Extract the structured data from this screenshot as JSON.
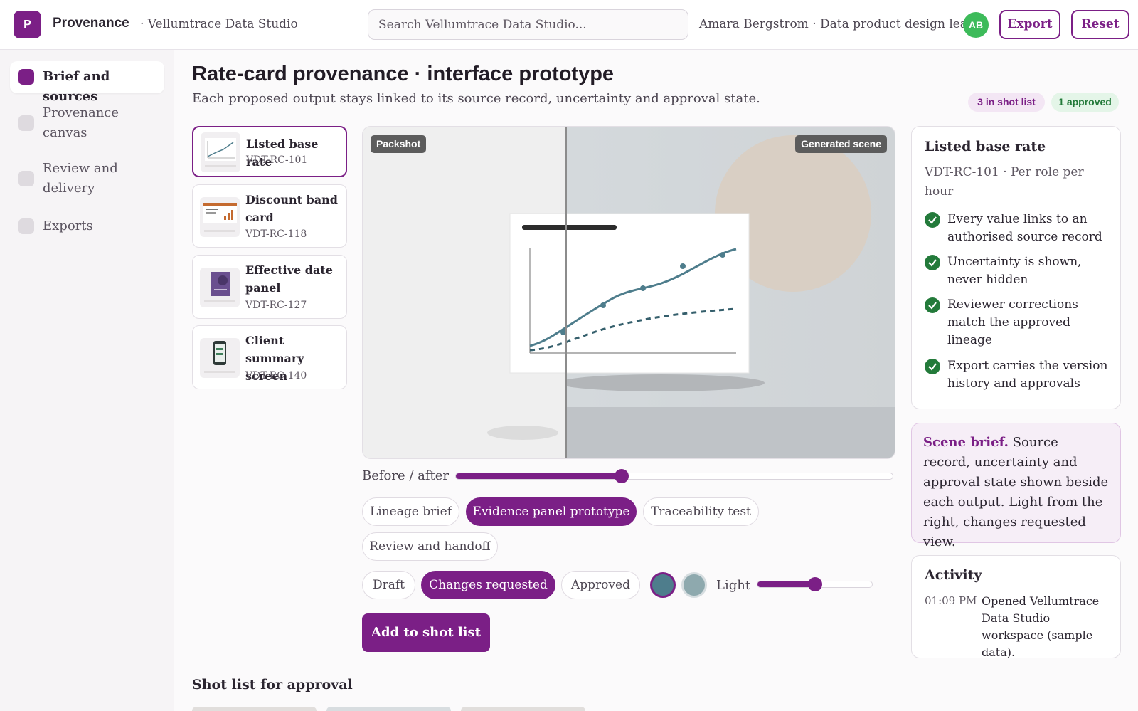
{
  "header": {
    "logo_letter": "P",
    "brand": "Provenance",
    "workspace": "· Vellumtrace Data Studio",
    "search_placeholder": "Search Vellumtrace Data Studio...",
    "user": "Amara Bergstrom · Data product design lead",
    "avatar_initials": "AB",
    "export_label": "Export",
    "reset_label": "Reset"
  },
  "sidebar": {
    "items": [
      {
        "label": "Brief and sources",
        "active": true
      },
      {
        "label": "Provenance canvas",
        "active": false
      },
      {
        "label": "Review and delivery",
        "active": false
      },
      {
        "label": "Exports",
        "active": false
      }
    ]
  },
  "main": {
    "title": "Rate-card provenance · interface prototype",
    "subtitle": "Each proposed output stays linked to its source record, uncertainty and approval state.",
    "badges": {
      "shot_list": "3 in shot list",
      "approved": "1 approved"
    }
  },
  "sources": [
    {
      "title": "Listed base rate",
      "code": "VDT-RC-101",
      "icon": "line-chart-thumb"
    },
    {
      "title": "Discount band card",
      "code": "VDT-RC-118",
      "icon": "bar-card-thumb"
    },
    {
      "title": "Effective date panel",
      "code": "VDT-RC-127",
      "icon": "date-panel-thumb"
    },
    {
      "title": "Client summary screen",
      "code": "VDT-RC-140",
      "icon": "phone-thumb"
    }
  ],
  "stage": {
    "left_tag": "Packshot",
    "right_tag": "Generated scene",
    "before_after_label": "Before / after",
    "before_after_value": 0.38
  },
  "tabs": [
    {
      "label": "Lineage brief",
      "active": false
    },
    {
      "label": "Evidence panel prototype",
      "active": true
    },
    {
      "label": "Traceability test",
      "active": false
    },
    {
      "label": "Review and handoff",
      "active": false
    }
  ],
  "status_options": [
    {
      "label": "Draft",
      "active": false
    },
    {
      "label": "Changes requested",
      "active": true
    },
    {
      "label": "Approved",
      "active": false
    }
  ],
  "swatches": [
    "#4e7d8c",
    "#8ea9ae"
  ],
  "light": {
    "label": "Light",
    "value": 0.5
  },
  "add_button": "Add to shot list",
  "shot_list_title": "Shot list for approval",
  "detail": {
    "title": "Listed base rate",
    "code": "VDT-RC-101 · Per role per hour",
    "checks": [
      "Every value links to an authorised source record",
      "Uncertainty is shown, never hidden",
      "Reviewer corrections match the approved lineage",
      "Export carries the version history and approvals"
    ]
  },
  "brief": {
    "lead": "Scene brief.",
    "text": "Source record, uncertainty and approval state shown beside each output. Light from the right, changes requested view."
  },
  "activity": {
    "title": "Activity",
    "time": "01:09 PM",
    "text": "Opened Vellumtrace Data Studio workspace (sample data)."
  },
  "colors": {
    "accent": "#7b1f86",
    "success": "#237a3a",
    "avatar": "#3dbb5a"
  }
}
